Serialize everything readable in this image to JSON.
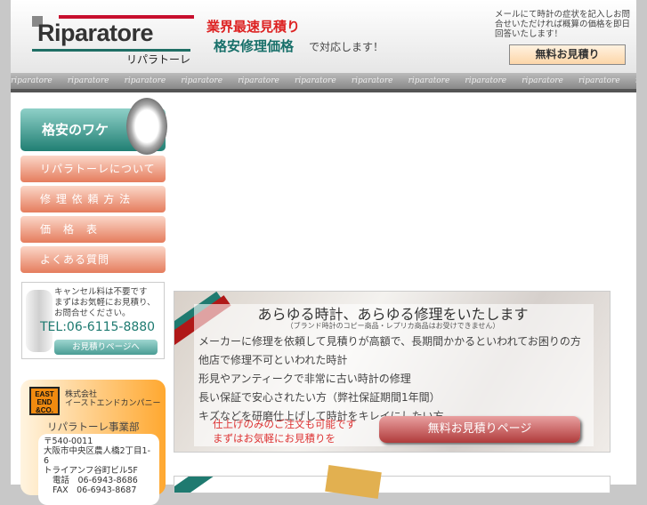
{
  "header": {
    "logo_text": "Riparatore",
    "logo_kana": "リパラトーレ",
    "tagline1": "業界最速見積り",
    "tagline2": "格安修理価格",
    "tagline3": "で対応します！",
    "mail_text": "メールにて時計の症状を記入しお問合せいただければ概算の価格を即日回答いたします！",
    "quote_button": "無料お見積り"
  },
  "stripe": {
    "pattern_text": "riparatore"
  },
  "sidebar": {
    "feature": "格安のワケ",
    "items": [
      {
        "label": "リパラトーレについて"
      },
      {
        "label": "修 理 依 頼 方 法"
      },
      {
        "label": "価　格　表"
      },
      {
        "label": "よくある質問"
      }
    ]
  },
  "cancel_box": {
    "line1": "キャンセル料は不要です",
    "line2": "まずはお気軽にお見積り、",
    "line3": "お問合せください。",
    "tel": "TEL:06-6115-8880",
    "button": "お見積りページへ"
  },
  "company": {
    "logo": "EAST END &CO.",
    "type": "株式会社",
    "name": "イーストエンドカンパニー",
    "division": "リパラトーレ事業部",
    "postal": "〒540-0011",
    "address1": "大阪市中央区農人橋2丁目1-6",
    "address2": "トライアンフ谷町ビル5F",
    "phone": "電話　06-6943-8686",
    "fax": "FAX　06-6943-8687"
  },
  "banner": {
    "heading": "あらゆる時計、あらゆる修理をいたします",
    "subnote": "（ブランド時計のコピー商品・レプリカ商品はお受けできません）",
    "lines": [
      "メーカーに修理を依頼して見積りが高額で、長期間かかるといわれてお困りの方",
      "他店で修理不可といわれた時計",
      "形見やアンティークで非常に古い時計の修理",
      "長い保証で安心されたい方（弊社保証期間1年間）",
      "キズなどを研磨仕上げして時計をキレイにしたい方"
    ],
    "red1": "仕上げのみのご注文も可能です",
    "red2": "まずはお気軽にお見積りを",
    "button": "無料お見積りページ"
  }
}
